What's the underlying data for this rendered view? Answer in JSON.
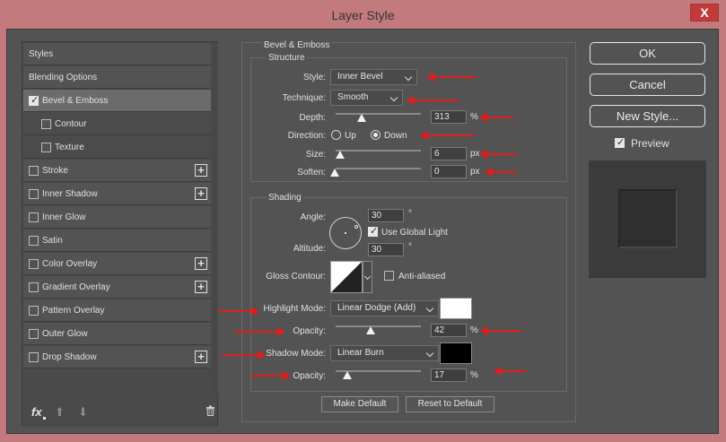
{
  "window": {
    "title": "Layer Style",
    "close_label": "X"
  },
  "left_panel": {
    "items": [
      {
        "label": "Styles",
        "checkbox": false,
        "checked": false,
        "plus": false,
        "selected": false,
        "sub": false
      },
      {
        "label": "Blending Options",
        "checkbox": false,
        "checked": false,
        "plus": false,
        "selected": false,
        "sub": false
      },
      {
        "label": "Bevel & Emboss",
        "checkbox": true,
        "checked": true,
        "plus": false,
        "selected": true,
        "sub": false
      },
      {
        "label": "Contour",
        "checkbox": true,
        "checked": false,
        "plus": false,
        "selected": false,
        "sub": true
      },
      {
        "label": "Texture",
        "checkbox": true,
        "checked": false,
        "plus": false,
        "selected": false,
        "sub": true
      },
      {
        "label": "Stroke",
        "checkbox": true,
        "checked": false,
        "plus": true,
        "selected": false,
        "sub": false
      },
      {
        "label": "Inner Shadow",
        "checkbox": true,
        "checked": false,
        "plus": true,
        "selected": false,
        "sub": false
      },
      {
        "label": "Inner Glow",
        "checkbox": true,
        "checked": false,
        "plus": false,
        "selected": false,
        "sub": false
      },
      {
        "label": "Satin",
        "checkbox": true,
        "checked": false,
        "plus": false,
        "selected": false,
        "sub": false
      },
      {
        "label": "Color Overlay",
        "checkbox": true,
        "checked": false,
        "plus": true,
        "selected": false,
        "sub": false
      },
      {
        "label": "Gradient Overlay",
        "checkbox": true,
        "checked": false,
        "plus": true,
        "selected": false,
        "sub": false
      },
      {
        "label": "Pattern Overlay",
        "checkbox": true,
        "checked": false,
        "plus": false,
        "selected": false,
        "sub": false
      },
      {
        "label": "Outer Glow",
        "checkbox": true,
        "checked": false,
        "plus": false,
        "selected": false,
        "sub": false
      },
      {
        "label": "Drop Shadow",
        "checkbox": true,
        "checked": false,
        "plus": true,
        "selected": false,
        "sub": false
      }
    ],
    "footer": {
      "fx_label": "fx",
      "up_icon": "arrow-up-icon",
      "down_icon": "arrow-down-icon",
      "trash_icon": "trash-icon"
    }
  },
  "bevel": {
    "section_title": "Bevel & Emboss",
    "structure": {
      "title": "Structure",
      "style_label": "Style:",
      "style_value": "Inner Bevel",
      "technique_label": "Technique:",
      "technique_value": "Smooth",
      "depth_label": "Depth:",
      "depth_value": "313",
      "depth_unit": "%",
      "direction_label": "Direction:",
      "direction_up": "Up",
      "direction_down": "Down",
      "direction_selected": "Down",
      "size_label": "Size:",
      "size_value": "6",
      "size_unit": "px",
      "soften_label": "Soften:",
      "soften_value": "0",
      "soften_unit": "px"
    },
    "shading": {
      "title": "Shading",
      "angle_label": "Angle:",
      "angle_value": "30",
      "angle_unit": "°",
      "use_global_light_label": "Use Global Light",
      "use_global_light": true,
      "altitude_label": "Altitude:",
      "altitude_value": "30",
      "altitude_unit": "°",
      "gloss_contour_label": "Gloss Contour:",
      "anti_aliased_label": "Anti-aliased",
      "anti_aliased": false,
      "highlight_mode_label": "Highlight Mode:",
      "highlight_mode_value": "Linear Dodge (Add)",
      "highlight_color": "#ffffff",
      "highlight_opacity_label": "Opacity:",
      "highlight_opacity_value": "42",
      "highlight_opacity_unit": "%",
      "shadow_mode_label": "Shadow Mode:",
      "shadow_mode_value": "Linear Burn",
      "shadow_color": "#000000",
      "shadow_opacity_label": "Opacity:",
      "shadow_opacity_value": "17",
      "shadow_opacity_unit": "%"
    },
    "make_default_label": "Make Default",
    "reset_default_label": "Reset to Default"
  },
  "right_panel": {
    "ok_label": "OK",
    "cancel_label": "Cancel",
    "new_style_label": "New Style...",
    "preview_label": "Preview",
    "preview_checked": true
  },
  "colors": {
    "annotation_arrow": "#e21c1c",
    "titlebar": "#c27a7c",
    "panel": "#535353"
  }
}
